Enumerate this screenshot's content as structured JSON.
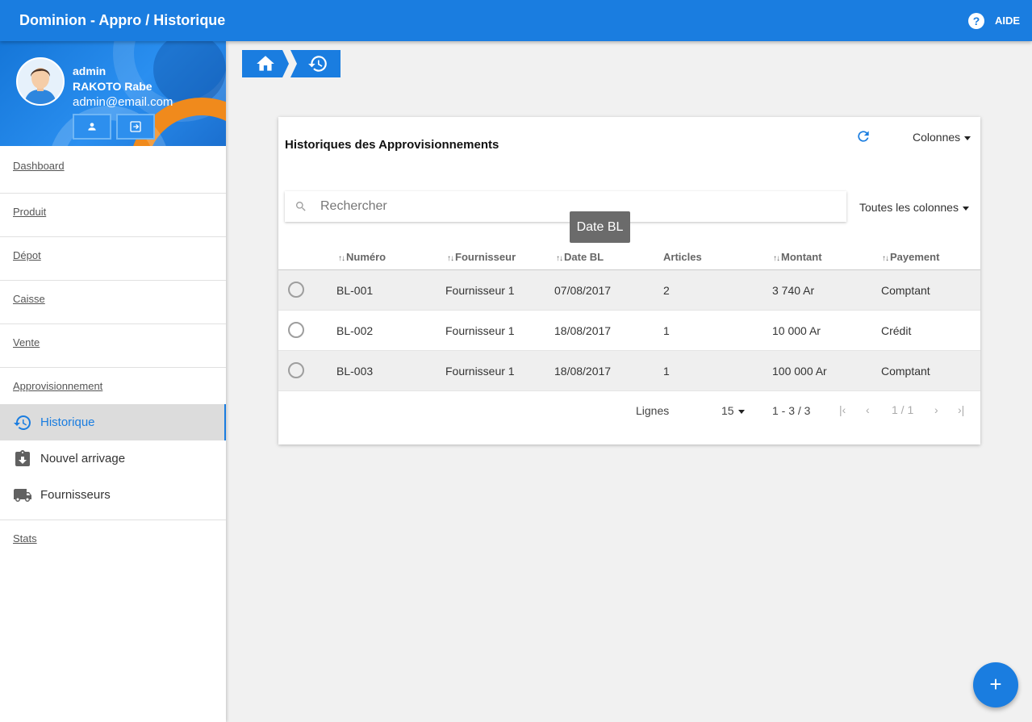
{
  "app": {
    "title": "Dominion - Appro / Historique",
    "help_label": "AIDE",
    "accent": "#1a7de0"
  },
  "user": {
    "username": "admin",
    "fullname": "RAKOTO Rabe",
    "email": "admin@email.com"
  },
  "sidebar": {
    "dashboard": "Dashboard",
    "produit": "Produit",
    "depot": "Dépot",
    "caisse": "Caisse",
    "vente": "Vente",
    "approvisionnement": "Approvisionnement",
    "sub_items": [
      {
        "label": "Historique",
        "icon": "history-icon",
        "active": true
      },
      {
        "label": "Nouvel arrivage",
        "icon": "clipboard-download-icon",
        "active": false
      },
      {
        "label": "Fournisseurs",
        "icon": "truck-icon",
        "active": false
      }
    ],
    "stats": "Stats"
  },
  "card": {
    "title": "Historiques des Approvisionnements",
    "columns_menu": "Colonnes",
    "search_placeholder": "Rechercher",
    "search_scope": "Toutes les colonnes",
    "tooltip": "Date BL",
    "headers": [
      "Numéro",
      "Fournisseur",
      "Date BL",
      "Articles",
      "Montant",
      "Payement"
    ],
    "rows": [
      [
        "BL-001",
        "Fournisseur 1",
        "07/08/2017",
        "2",
        "3 740 Ar",
        "Comptant"
      ],
      [
        "BL-002",
        "Fournisseur 1",
        "18/08/2017",
        "1",
        "10 000 Ar",
        "Crédit"
      ],
      [
        "BL-003",
        "Fournisseur 1",
        "18/08/2017",
        "1",
        "100 000 Ar",
        "Comptant"
      ]
    ],
    "footer": {
      "rows_label": "Lignes",
      "rows_per_page": "15",
      "range": "1 - 3 / 3",
      "page": "1 / 1"
    }
  },
  "fab_label": "+"
}
